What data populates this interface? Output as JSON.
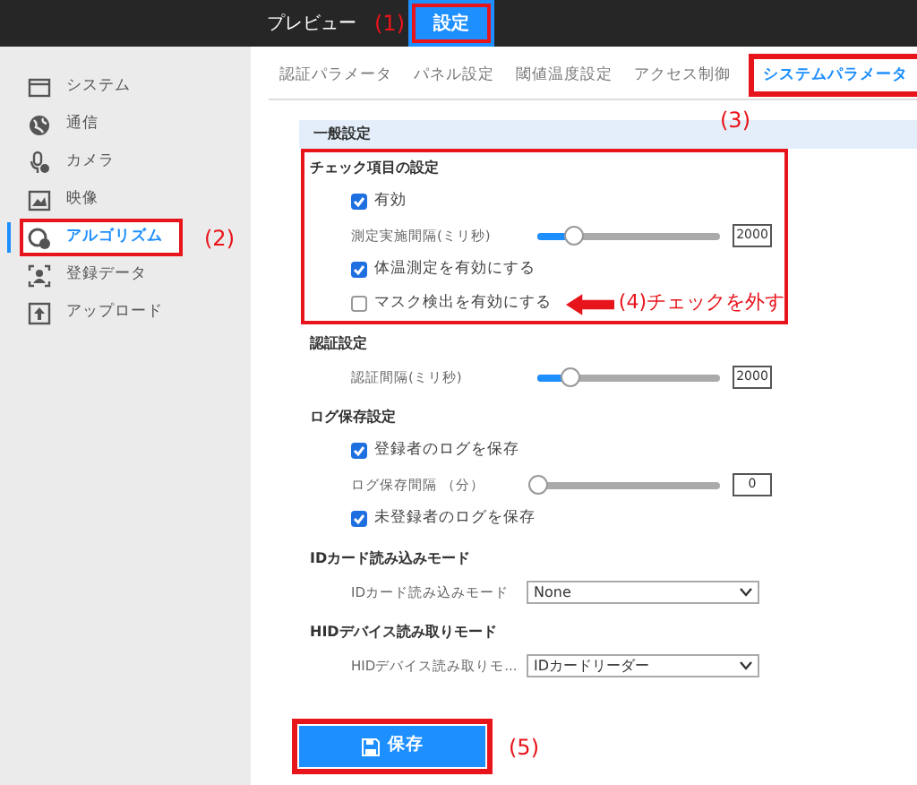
{
  "top_nav": {
    "items": [
      {
        "label": "プレビュー",
        "selected": false
      },
      {
        "label": "設定",
        "selected": true,
        "annotation": "(1)"
      }
    ]
  },
  "sidebar": {
    "items": [
      {
        "label": "システム",
        "selected": false
      },
      {
        "label": "通信",
        "selected": false
      },
      {
        "label": "カメラ",
        "selected": false
      },
      {
        "label": "映像",
        "selected": false
      },
      {
        "label": "アルゴリズム",
        "selected": true,
        "annotation": "(2)"
      },
      {
        "label": "登録データ",
        "selected": false
      },
      {
        "label": "アップロード",
        "selected": false
      }
    ]
  },
  "tabs": [
    {
      "label": "認証パラメータ",
      "selected": false
    },
    {
      "label": "パネル設定",
      "selected": false
    },
    {
      "label": "閾値温度設定",
      "selected": false
    },
    {
      "label": "アクセス制御",
      "selected": false
    },
    {
      "label": "システムパラメータ",
      "selected": true,
      "annotation": "(3)"
    }
  ],
  "panel_header": "一般設定",
  "sections": [
    {
      "title": "チェック項目の設定",
      "highlighted": true,
      "rows": [
        {
          "kind": "checkbox",
          "label": "有効",
          "checked": true
        },
        {
          "kind": "slider",
          "label": "測定実施間隔(ミリ秒)",
          "level": 0.2,
          "value": "2000"
        },
        {
          "kind": "checkbox",
          "label": "体温測定を有効にする",
          "checked": true
        },
        {
          "kind": "checkbox",
          "label": "マスク検出を有効にする",
          "checked": false,
          "annotation": "(4)チェックを外す"
        }
      ]
    },
    {
      "title": "認証設定",
      "highlighted": false,
      "rows": [
        {
          "kind": "slider",
          "label": "認証間隔(ミリ秒)",
          "level": 0.18,
          "value": "2000"
        }
      ]
    },
    {
      "title": "ログ保存設定",
      "highlighted": false,
      "rows": [
        {
          "kind": "checkbox",
          "label": "登録者のログを保存",
          "checked": true
        },
        {
          "kind": "slider",
          "label": "ログ保存間隔 （分）",
          "level": 0,
          "value": "0"
        },
        {
          "kind": "checkbox",
          "label": "未登録者のログを保存",
          "checked": true
        }
      ]
    },
    {
      "title": "IDカード読み込みモード",
      "highlighted": false,
      "rows": [
        {
          "kind": "select",
          "label": "IDカード読み込みモード",
          "value": "None"
        }
      ]
    },
    {
      "title": "HIDデバイス読み取りモード",
      "highlighted": false,
      "rows": [
        {
          "kind": "select",
          "label": "HIDデバイス読み取りモ...",
          "value": "IDカードリーダー"
        }
      ]
    }
  ],
  "save_button": {
    "label": "保存",
    "annotation": "(5)"
  }
}
